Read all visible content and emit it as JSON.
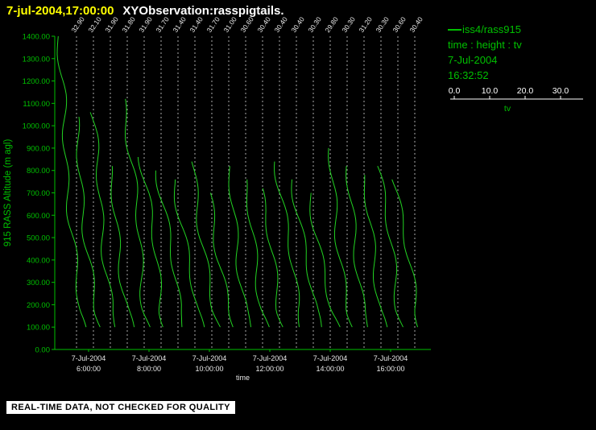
{
  "colors": {
    "background": "#000000",
    "title_yellow": "#ffff00",
    "title_white": "#ffffff",
    "green": "#00c000",
    "trace_green": "#22d322",
    "dashed_line": "#bdbdbd",
    "white_text": "#e8e8e8",
    "footer_bg": "#ffffff",
    "footer_text": "#000000"
  },
  "header": {
    "datetime": "7-jul-2004,17:00:00",
    "title": "XYObservation:rasspigtails."
  },
  "chart_data": {
    "type": "line",
    "title": "",
    "ylabel": "915 RASS Altitude (m agl)",
    "xlabel": "time",
    "ylim": [
      0,
      1400
    ],
    "ytick_labels": [
      "0.00",
      "100.00",
      "200.00",
      "300.00",
      "400.00",
      "500.00",
      "600.00",
      "700.00",
      "800.00",
      "900.00",
      "1000.00",
      "1100.00",
      "1200.00",
      "1300.00",
      "1400.00"
    ],
    "x_ticks": [
      {
        "date": "7-Jul-2004",
        "time": "6:00:00"
      },
      {
        "date": "7-Jul-2004",
        "time": "8:00:00"
      },
      {
        "date": "7-Jul-2004",
        "time": "10:00:00"
      },
      {
        "date": "7-Jul-2004",
        "time": "12:00:00"
      },
      {
        "date": "7-Jul-2004",
        "time": "14:00:00"
      },
      {
        "date": "7-Jul-2004",
        "time": "16:00:00"
      }
    ],
    "series_name": "iss4/rass915",
    "legend_position": "top-right",
    "grid": "dashed vertical line per profile",
    "profiles": [
      {
        "top_label": "32.90",
        "top_height_m": 1400
      },
      {
        "top_label": "32.10",
        "top_height_m": 1050
      },
      {
        "top_label": "31.90",
        "top_height_m": 1060
      },
      {
        "top_label": "31.80",
        "top_height_m": 820
      },
      {
        "top_label": "31.90",
        "top_height_m": 1120
      },
      {
        "top_label": "31.70",
        "top_height_m": 860
      },
      {
        "top_label": "31.40",
        "top_height_m": 800
      },
      {
        "top_label": "31.40",
        "top_height_m": 760
      },
      {
        "top_label": "31.70",
        "top_height_m": 850
      },
      {
        "top_label": "31.00",
        "top_height_m": 700
      },
      {
        "top_label": "30.60",
        "top_height_m": 830
      },
      {
        "top_label": "30.40",
        "top_height_m": 760
      },
      {
        "top_label": "30.40",
        "top_height_m": 720
      },
      {
        "top_label": "30.40",
        "top_height_m": 850
      },
      {
        "top_label": "30.30",
        "top_height_m": 760
      },
      {
        "top_label": "29.80",
        "top_height_m": 700
      },
      {
        "top_label": "30.30",
        "top_height_m": 900
      },
      {
        "top_label": "31.20",
        "top_height_m": 830
      },
      {
        "top_label": "30.30",
        "top_height_m": 780
      },
      {
        "top_label": "30.60",
        "top_height_m": 830
      },
      {
        "top_label": "30.40",
        "top_height_m": 760
      }
    ],
    "tv_axis": {
      "tick_labels": [
        "0.0",
        "10.0",
        "20.0",
        "30.0"
      ],
      "label": "tv",
      "range": [
        0,
        30
      ]
    }
  },
  "legend": {
    "series": "iss4/rass915",
    "mapping": "time : height : tv",
    "date": "7-Jul-2004",
    "time": "16:32:52"
  },
  "footer": {
    "notice": "REAL-TIME DATA, NOT CHECKED FOR QUALITY"
  }
}
